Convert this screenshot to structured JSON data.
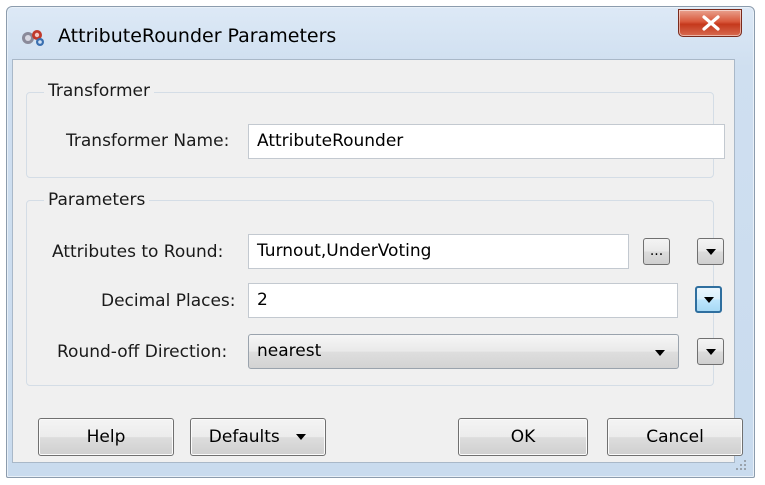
{
  "window": {
    "title": "AttributeRounder Parameters"
  },
  "transformer_group": {
    "legend": "Transformer",
    "name_label": "Transformer Name:",
    "name_value": "AttributeRounder"
  },
  "parameters_group": {
    "legend": "Parameters",
    "attributes_label": "Attributes to Round:",
    "attributes_value": "Turnout,UnderVoting",
    "attributes_browse": "...",
    "decimal_label": "Decimal Places:",
    "decimal_value": "2",
    "roundoff_label": "Round-off Direction:",
    "roundoff_value": "nearest"
  },
  "buttons": {
    "help": "Help",
    "defaults": "Defaults",
    "ok": "OK",
    "cancel": "Cancel"
  },
  "icons": {
    "app": "transformer-icon",
    "close": "close-icon",
    "dropdown": "chevron-down-icon"
  },
  "colors": {
    "close_button": "#c5391c",
    "focus_border": "#2f6f9f"
  }
}
